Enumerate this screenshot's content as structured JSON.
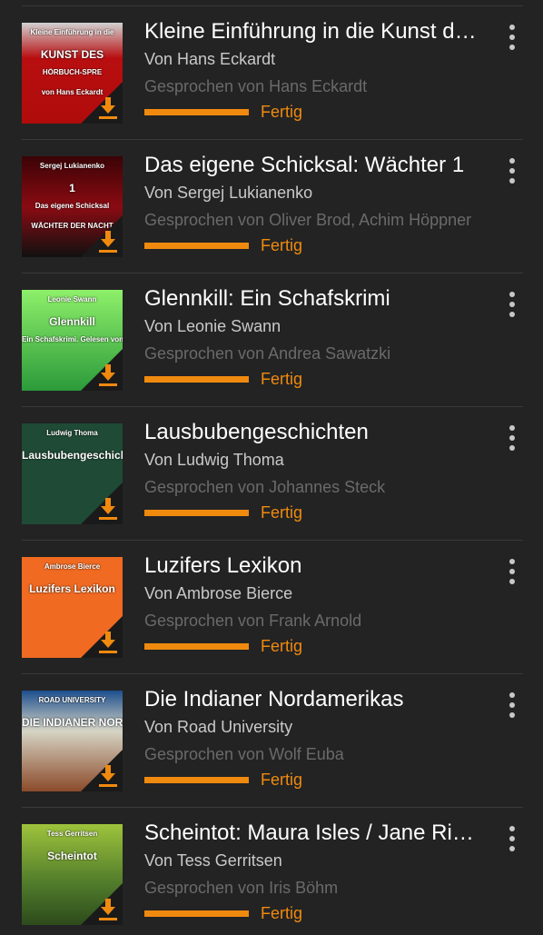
{
  "colors": {
    "accent": "#f08a0f",
    "background": "#232323"
  },
  "books": [
    {
      "title": "Kleine Einführung in die Kunst des Hörbuchsprechens",
      "author": "Von Hans Eckardt",
      "narrator": "Gesprochen von Hans Eckardt",
      "status": "Fertig",
      "progress": 1.0,
      "cover": {
        "bg": "linear-gradient(180deg,#d2d2d2 0%,#b80e10 35%,#b00c0c 100%)",
        "lines": [
          "Kleine Einführung in die",
          "KUNST DES",
          "HÖRBUCH-SPRE",
          "von Hans Eckardt"
        ]
      }
    },
    {
      "title": "Das eigene Schicksal: Wächter 1",
      "author": "Von Sergej Lukianenko",
      "narrator": "Gesprochen von Oliver Brod, Achim Höppner",
      "status": "Fertig",
      "progress": 1.0,
      "cover": {
        "bg": "linear-gradient(180deg,#3a0306 0%,#8a0b12 50%,#111 100%)",
        "lines": [
          "Sergej Lukianenko",
          "1",
          "Das eigene Schicksal",
          "WÄCHTER DER NACHT"
        ]
      }
    },
    {
      "title": "Glennkill: Ein Schafskrimi",
      "author": "Von Leonie Swann",
      "narrator": "Gesprochen von Andrea Sawatzki",
      "status": "Fertig",
      "progress": 1.0,
      "cover": {
        "bg": "linear-gradient(180deg,#8ef06a 0%,#2b9a3a 100%)",
        "lines": [
          "Leonie Swann",
          "Glennkill",
          "Ein Schafskrimi. Gelesen von Andrea Sawatzki"
        ]
      }
    },
    {
      "title": "Lausbubengeschichten",
      "author": "Von Ludwig Thoma",
      "narrator": "Gesprochen von Johannes Steck",
      "status": "Fertig",
      "progress": 1.0,
      "cover": {
        "bg": "#1f4a36",
        "lines": [
          "Ludwig Thoma",
          "Lausbubengeschichten"
        ]
      }
    },
    {
      "title": "Luzifers Lexikon",
      "author": "Von Ambrose Bierce",
      "narrator": "Gesprochen von Frank Arnold",
      "status": "Fertig",
      "progress": 1.0,
      "cover": {
        "bg": "#f06a22",
        "lines": [
          "Ambrose Bierce",
          "Luzifers Lexikon"
        ]
      }
    },
    {
      "title": "Die Indianer Nordamerikas",
      "author": "Von Road University",
      "narrator": "Gesprochen von Wolf Euba",
      "status": "Fertig",
      "progress": 1.0,
      "cover": {
        "bg": "linear-gradient(180deg,#1c4f8e 0%,#d6d4c4 40%,#8b4a2a 100%)",
        "lines": [
          "ROAD UNIVERSITY",
          "DIE INDIANER NORDAMERIKAS"
        ]
      }
    },
    {
      "title": "Scheintot: Maura Isles / Jane Rizzoli",
      "author": "Von Tess Gerritsen",
      "narrator": "Gesprochen von Iris Böhm",
      "status": "Fertig",
      "progress": 1.0,
      "cover": {
        "bg": "linear-gradient(180deg,#9ec33c 0%,#4f7a2a 60%,#2d4a1c 100%)",
        "lines": [
          "Tess Gerritsen",
          "Scheintot"
        ]
      }
    }
  ]
}
